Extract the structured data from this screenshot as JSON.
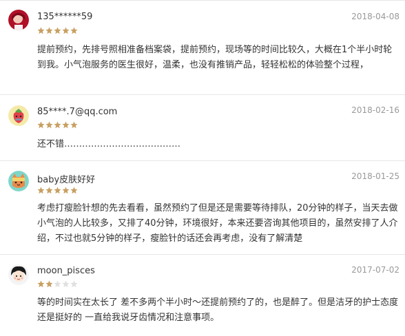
{
  "reviews": [
    {
      "username": "135******59",
      "date": "2018-04-08",
      "rating": 5,
      "avatar_icon": "girl-avatar-icon",
      "content": "提前预约，先排号照相准备档案袋，提前预约，现场等的时间比较久，大概在1个半小时轮到我。小气泡服务的医生很好，温柔，也没有推销产品，轻轻松松的体验整个过程，"
    },
    {
      "username": "85****.7@qq.com",
      "date": "2018-02-16",
      "rating": 5,
      "avatar_icon": "strawberry-avatar-icon",
      "content": "还不错…………………………………"
    },
    {
      "username": "baby皮肤好好",
      "date": "2018-01-25",
      "rating": 5,
      "avatar_icon": "cat-avatar-icon",
      "content": "考虑打瘦脸针想的先去看看，虽然预约了但是还是需要等待排队，20分钟的样子，当天去做小气泡的人比较多，又排了40分钟，环境很好，本来还要咨询其他项目的，虽然安排了人介绍，不过也就5分钟的样子，瘦脸针的话还会再考虑，没有了解清楚"
    },
    {
      "username": "moon_pisces",
      "date": "2017-07-02",
      "rating": 2,
      "avatar_icon": "cartoon-girl-avatar-icon",
      "content": "等的时间实在太长了 差不多两个半小时～还提前预约了的，也是醉了。但是洁牙的护士态度还是挺好的 一直给我说牙齿情况和注意事项。"
    }
  ],
  "colors": {
    "star_filled": "#c8a062",
    "star_empty": "#e0e0e0",
    "divider": "#e6e6e6",
    "date": "#999999",
    "text": "#333333"
  }
}
